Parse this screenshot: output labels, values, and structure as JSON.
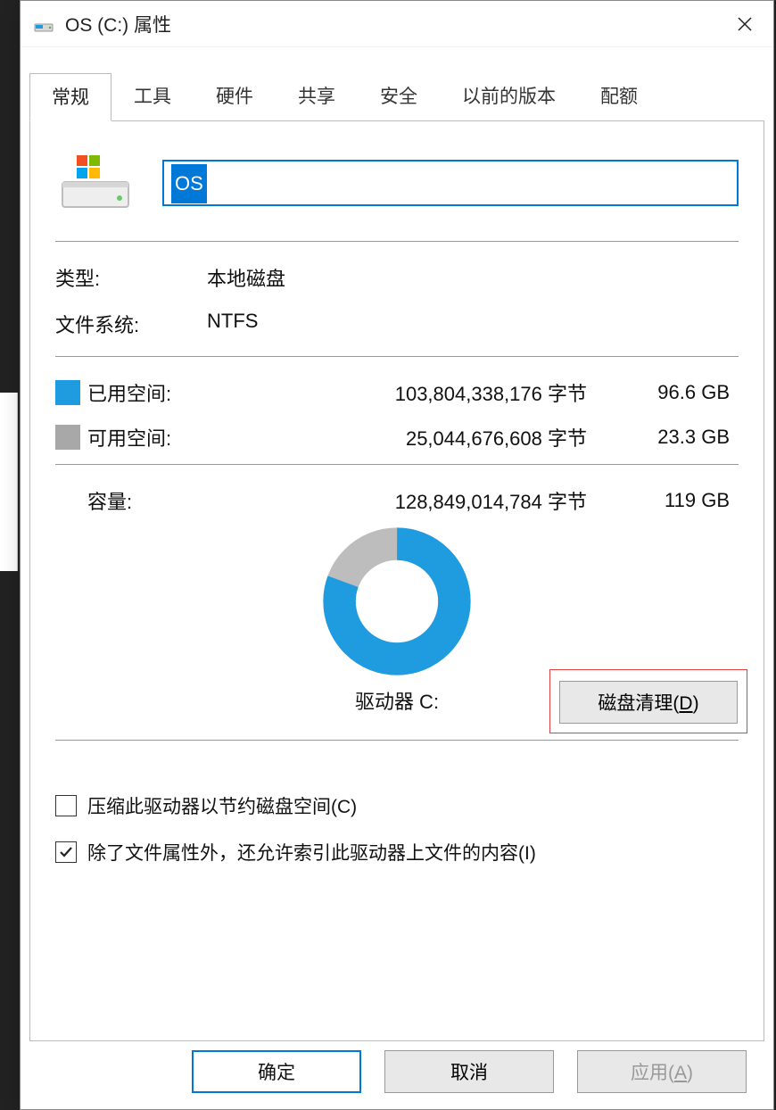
{
  "title": "OS (C:) 属性",
  "tabs": [
    "常规",
    "工具",
    "硬件",
    "共享",
    "安全",
    "以前的版本",
    "配额"
  ],
  "drive_name": "OS",
  "type_label": "类型:",
  "type_value": "本地磁盘",
  "fs_label": "文件系统:",
  "fs_value": "NTFS",
  "used_label": "已用空间:",
  "used_bytes": "103,804,338,176 字节",
  "used_gb": "96.6 GB",
  "free_label": "可用空间:",
  "free_bytes": "25,044,676,608 字节",
  "free_gb": "23.3 GB",
  "cap_label": "容量:",
  "cap_bytes": "128,849,014,784 字节",
  "cap_gb": "119 GB",
  "drive_caption": "驱动器 C:",
  "cleanup_prefix": "磁盘清理(",
  "cleanup_key": "D",
  "cleanup_suffix": ")",
  "compress_label": "压缩此驱动器以节约磁盘空间(C)",
  "index_label": "除了文件属性外，还允许索引此驱动器上文件的内容(I)",
  "ok_label": "确定",
  "cancel_label": "取消",
  "apply_prefix": "应用(",
  "apply_key": "A",
  "apply_suffix": ")",
  "chart_data": {
    "type": "pie",
    "title": "驱动器 C:",
    "series": [
      {
        "name": "已用空间",
        "value": 103804338176,
        "color": "#1e9cdf"
      },
      {
        "name": "可用空间",
        "value": 25044676608,
        "color": "#a8a8a8"
      }
    ]
  }
}
